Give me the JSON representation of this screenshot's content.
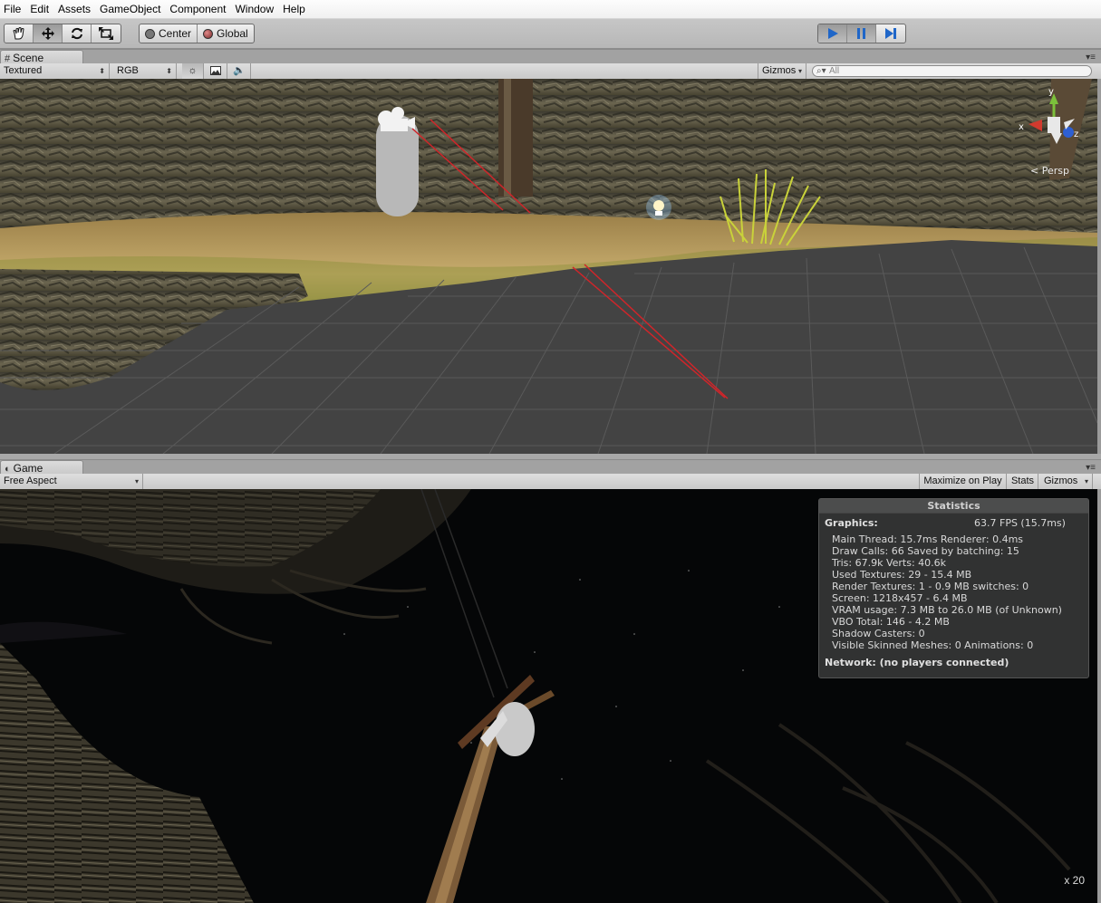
{
  "menu": [
    "File",
    "Edit",
    "Assets",
    "GameObject",
    "Component",
    "Window",
    "Help"
  ],
  "toolbar": {
    "tools": [
      "hand-icon",
      "move-icon",
      "rotate-icon",
      "scale-icon"
    ],
    "pivot_label": "Center",
    "space_label": "Global",
    "play_controls": [
      "play-icon",
      "pause-icon",
      "step-icon"
    ],
    "play_active_color": "#3d7fd6"
  },
  "scene": {
    "tab_label": "Scene",
    "render_mode": "Textured",
    "color_mode": "RGB",
    "gizmos_label": "Gizmos",
    "search_placeholder": "All",
    "axis_labels": {
      "x": "x",
      "y": "y",
      "z": "z"
    },
    "projection_label": "Persp",
    "colors": {
      "grid": "#4a4a4a",
      "ground": "#a58a55",
      "rock": "#5a5540",
      "grass": "#7da22a",
      "gizmo_line": "#d0252a"
    }
  },
  "game": {
    "tab_label": "Game",
    "aspect": "Free Aspect",
    "maximize_label": "Maximize on Play",
    "stats_label": "Stats",
    "gizmos_label": "Gizmos",
    "scale_label": "x 20",
    "stats": {
      "title": "Statistics",
      "graphics_label": "Graphics:",
      "fps": "63.7 FPS (15.7ms)",
      "lines": [
        "Main Thread: 15.7ms  Renderer: 0.4ms",
        "Draw Calls: 66     Saved by batching: 15",
        "Tris: 67.9k   Verts: 40.6k",
        "Used Textures: 29 - 15.4 MB",
        "Render Textures: 1 - 0.9 MB switches: 0",
        "Screen: 1218x457 - 6.4 MB",
        "VRAM usage: 7.3 MB to 26.0 MB (of Unknown)",
        "VBO Total: 146 - 4.2 MB",
        "Shadow Casters: 0",
        "Visible Skinned Meshes: 0     Animations: 0"
      ],
      "network": "Network: (no players connected)"
    }
  }
}
